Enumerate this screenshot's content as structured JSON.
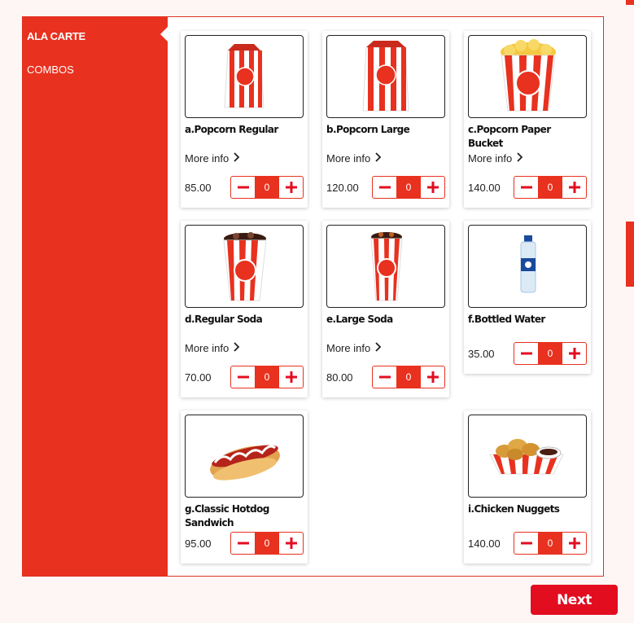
{
  "sidebar": {
    "items": [
      {
        "label": "ALA CARTE",
        "active": true
      },
      {
        "label": "COMBOS",
        "active": false
      }
    ]
  },
  "more_info_label": "More info",
  "products": [
    {
      "name": "a.Popcorn Regular",
      "price": "85.00",
      "qty": "0",
      "icon": "popcorn-bag-icon"
    },
    {
      "name": "b.Popcorn Large",
      "price": "120.00",
      "qty": "0",
      "icon": "popcorn-bag-icon"
    },
    {
      "name": "c.Popcorn Paper Bucket",
      "price": "140.00",
      "qty": "0",
      "icon": "popcorn-bucket-icon"
    },
    {
      "name": "d.Regular Soda",
      "price": "70.00",
      "qty": "0",
      "icon": "soda-cup-icon"
    },
    {
      "name": "e.Large Soda",
      "price": "80.00",
      "qty": "0",
      "icon": "soda-cup-icon"
    },
    {
      "name": "f.Bottled Water",
      "price": "35.00",
      "qty": "0",
      "icon": "water-bottle-icon"
    },
    {
      "name": "g.Classic Hotdog Sandwich",
      "price": "95.00",
      "qty": "0",
      "icon": "hotdog-icon"
    },
    {
      "name": "i.Chicken Nuggets",
      "price": "140.00",
      "qty": "0",
      "icon": "chicken-nuggets-icon"
    }
  ],
  "next_label": "Next",
  "colors": {
    "accent": "#e8311f",
    "next": "#e30d20"
  }
}
